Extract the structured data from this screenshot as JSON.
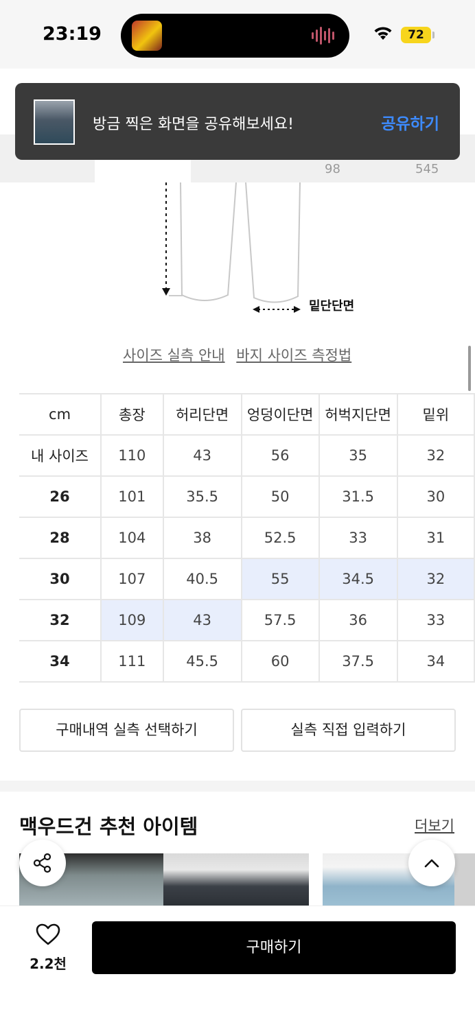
{
  "status_bar": {
    "time": "23:19",
    "battery": "72",
    "icons": [
      "now-playing-art-icon",
      "audio-wave-icon",
      "wifi-icon",
      "battery-icon"
    ]
  },
  "toast": {
    "message": "방금 찍은 화면을 공유해보세요!",
    "action": "공유하기"
  },
  "tabs": {
    "counts": [
      "98",
      "545"
    ]
  },
  "diagram": {
    "leg_label": "밑단단면"
  },
  "size_links": [
    "사이즈 실측 안내",
    "바지 사이즈 측정법"
  ],
  "size_table": {
    "headers": [
      "cm",
      "총장",
      "허리단면",
      "엉덩이단면",
      "허벅지단면",
      "밑위"
    ],
    "rows": [
      {
        "label": "내 사이즈",
        "values": [
          "110",
          "43",
          "56",
          "35",
          "32"
        ]
      },
      {
        "label": "26",
        "values": [
          "101",
          "35.5",
          "50",
          "31.5",
          "30"
        ]
      },
      {
        "label": "28",
        "values": [
          "104",
          "38",
          "52.5",
          "33",
          "31"
        ]
      },
      {
        "label": "30",
        "values": [
          "107",
          "40.5",
          "55",
          "34.5",
          "32"
        ]
      },
      {
        "label": "32",
        "values": [
          "109",
          "43",
          "57.5",
          "36",
          "33"
        ]
      },
      {
        "label": "34",
        "values": [
          "111",
          "45.5",
          "60",
          "37.5",
          "34"
        ]
      }
    ]
  },
  "actions": {
    "purchase_history": "구매내역 실측 선택하기",
    "manual_input": "실측 직접 입력하기"
  },
  "recommend": {
    "title": "맥우드건 추천 아이템",
    "more": "더보기"
  },
  "bottom_bar": {
    "like_count": "2.2천",
    "buy": "구매하기"
  },
  "colors": {
    "highlight": "#e8eefc",
    "toast_action": "#3d8bff",
    "battery": "#f7d51d"
  }
}
